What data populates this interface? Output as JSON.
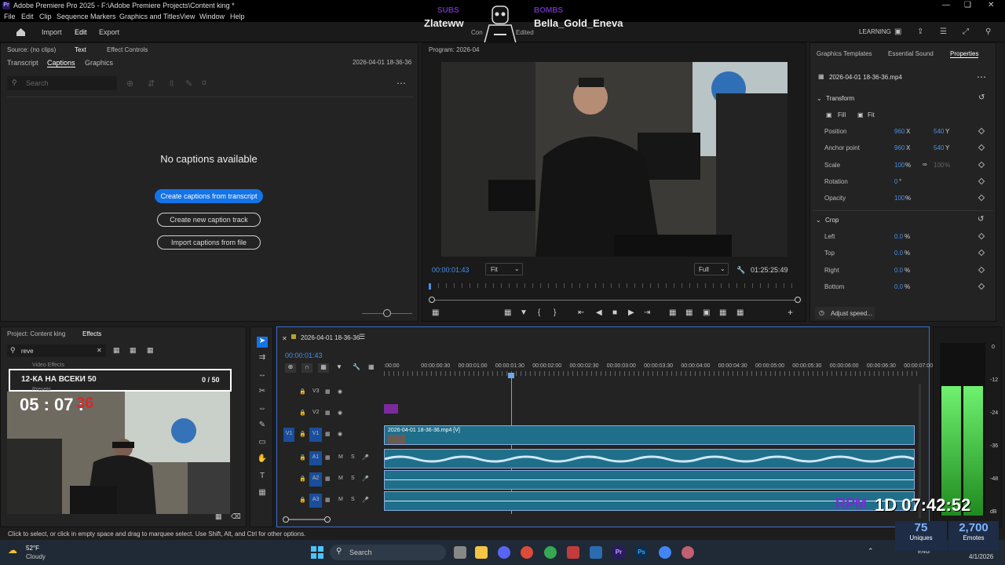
{
  "title_bar": {
    "title": "Adobe Premiere Pro 2025 - F:\\Adobe Premiere Projects\\Content king *",
    "app_icon": "Pr"
  },
  "menu": [
    "File",
    "Edit",
    "Clip",
    "Sequence",
    "Markers",
    "Graphics and Titles",
    "View",
    "Window",
    "Help"
  ],
  "workspace": {
    "tabs": [
      "Import",
      "Edit",
      "Export"
    ],
    "right": "LEARNING"
  },
  "overlay_top": {
    "subs": "SUBS",
    "bombs": "BOMBS",
    "left_name": "Zlateww",
    "right_name": "Bella_Gold_Eneva",
    "edited": "Edited",
    "partial": "Con"
  },
  "source_panel": {
    "source": "Source: (no clips)",
    "text": "Text",
    "effect_controls": "Effect Controls",
    "tabs": [
      "Transcript",
      "Captions",
      "Graphics"
    ],
    "timestamp": "2026-04-01 18-36-36",
    "search_placeholder": "Search",
    "no_captions": "No captions available",
    "btn_create_transcript": "Create captions from transcript",
    "btn_new_track": "Create new caption track",
    "btn_import": "Import captions from file"
  },
  "program": {
    "title": "Program: 2026-04",
    "timecode": "00:00:01:43",
    "fit": "Fit",
    "quality": "Full",
    "duration": "01:25:25:49"
  },
  "properties": {
    "tabs": [
      "Graphics Templates",
      "Essential Sound",
      "Properties"
    ],
    "clip": "2026-04-01 18-36-36.mp4",
    "transform": "Transform",
    "fill": "Fill",
    "fit": "Fit",
    "rows": [
      {
        "label": "Position",
        "v1": "960",
        "u1": "X",
        "v2": "540",
        "u2": "Y"
      },
      {
        "label": "Anchor point",
        "v1": "960",
        "u1": "X",
        "v2": "540",
        "u2": "Y"
      },
      {
        "label": "Scale",
        "v1": "100",
        "u1": "%",
        "v2": "100",
        "u2": "%"
      },
      {
        "label": "Rotation",
        "v1": "0",
        "u1": "°",
        "v2": "",
        "u2": ""
      },
      {
        "label": "Opacity",
        "v1": "100",
        "u1": "%",
        "v2": "",
        "u2": ""
      }
    ],
    "crop": "Crop",
    "crop_rows": [
      {
        "label": "Left",
        "v": "0.0",
        "u": "%"
      },
      {
        "label": "Top",
        "v": "0.0",
        "u": "%"
      },
      {
        "label": "Right",
        "v": "0.0",
        "u": "%"
      },
      {
        "label": "Bottom",
        "v": "0.0",
        "u": "%"
      }
    ],
    "adjust_speed": "Adjust speed..."
  },
  "project": {
    "project_tab": "Project: Content king",
    "effects_tab": "Effects",
    "search_value": "reve",
    "video_effects": "Video Effects",
    "presets": "Presets",
    "overlay_title": "12-КА НА ВСЕКИ 50",
    "overlay_count": "0 / 50",
    "overlay_timer": "05 : 07 :",
    "overlay_timer_red": "36"
  },
  "timeline": {
    "sequence": "2026-04-01 18-36-36",
    "timecode": "00:00:01:43",
    "ruler": [
      ":00:00",
      "00:00:00:30",
      "00:00:01:00",
      "00:00:01:30",
      "00:00:02:00",
      "00:00:02:30",
      "00:00:03:00",
      "00:00:03:30",
      "00:00:04:00",
      "00:00:04:30",
      "00:00:05:00",
      "00:00:05:30",
      "00:00:06:00",
      "00:00:06:30",
      "00:00:07:00"
    ],
    "tracks": [
      {
        "name": "V3",
        "src": ""
      },
      {
        "name": "V2",
        "src": ""
      },
      {
        "name": "V1",
        "src": "V1"
      },
      {
        "name": "A1",
        "src": "A1"
      },
      {
        "name": "A2",
        "src": ""
      },
      {
        "name": "A3",
        "src": ""
      }
    ],
    "clip_label": "2026-04-01 18-36-36.mp4 [V]",
    "meter": [
      "0",
      "-12",
      "-24",
      "-36",
      "-48",
      "dB"
    ]
  },
  "status": "Click to select, or click in empty space and drag to marquee select. Use Shift, Alt, and Ctrl for other options.",
  "stream_overlay": {
    "rpm": "RPM",
    "clock": "1D 07:42:52",
    "uniques_n": "75",
    "uniques": "Uniques",
    "emotes_n": "2,700",
    "emotes": "Emotes"
  },
  "taskbar": {
    "temp": "52°F",
    "weather": "Cloudy",
    "search": "Search",
    "lang": "ENG",
    "date": "4/1/2026"
  }
}
